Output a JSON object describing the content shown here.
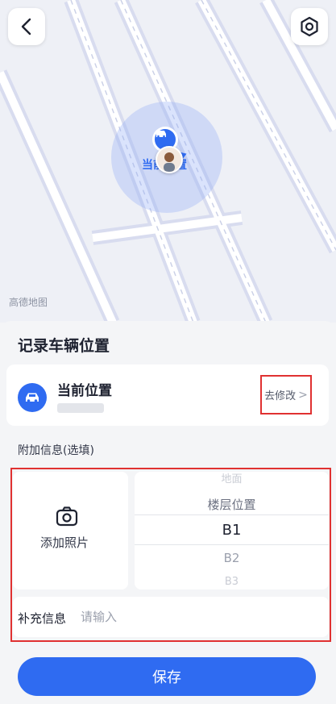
{
  "map": {
    "credit": "高德地图",
    "location_label": "当前位置",
    "marker_icon": "car-icon"
  },
  "header": {
    "back_icon": "chevron-left-icon",
    "settings_icon": "hexagon-gear-icon"
  },
  "sheet": {
    "title": "记录车辆位置",
    "position": {
      "title": "当前位置",
      "modify_label": "去修改",
      "modify_chevron": ">"
    },
    "extra_label": "附加信息(选填)",
    "photo": {
      "label": "添加照片",
      "icon": "camera-icon"
    },
    "floor_picker": {
      "items": [
        "地面",
        "楼层位置",
        "B1",
        "B2",
        "B3"
      ],
      "selected": "B1"
    },
    "note": {
      "label": "补充信息",
      "placeholder": "请输入"
    },
    "save_label": "保存"
  },
  "colors": {
    "accent": "#2f6bf1",
    "highlight": "#e03131"
  }
}
